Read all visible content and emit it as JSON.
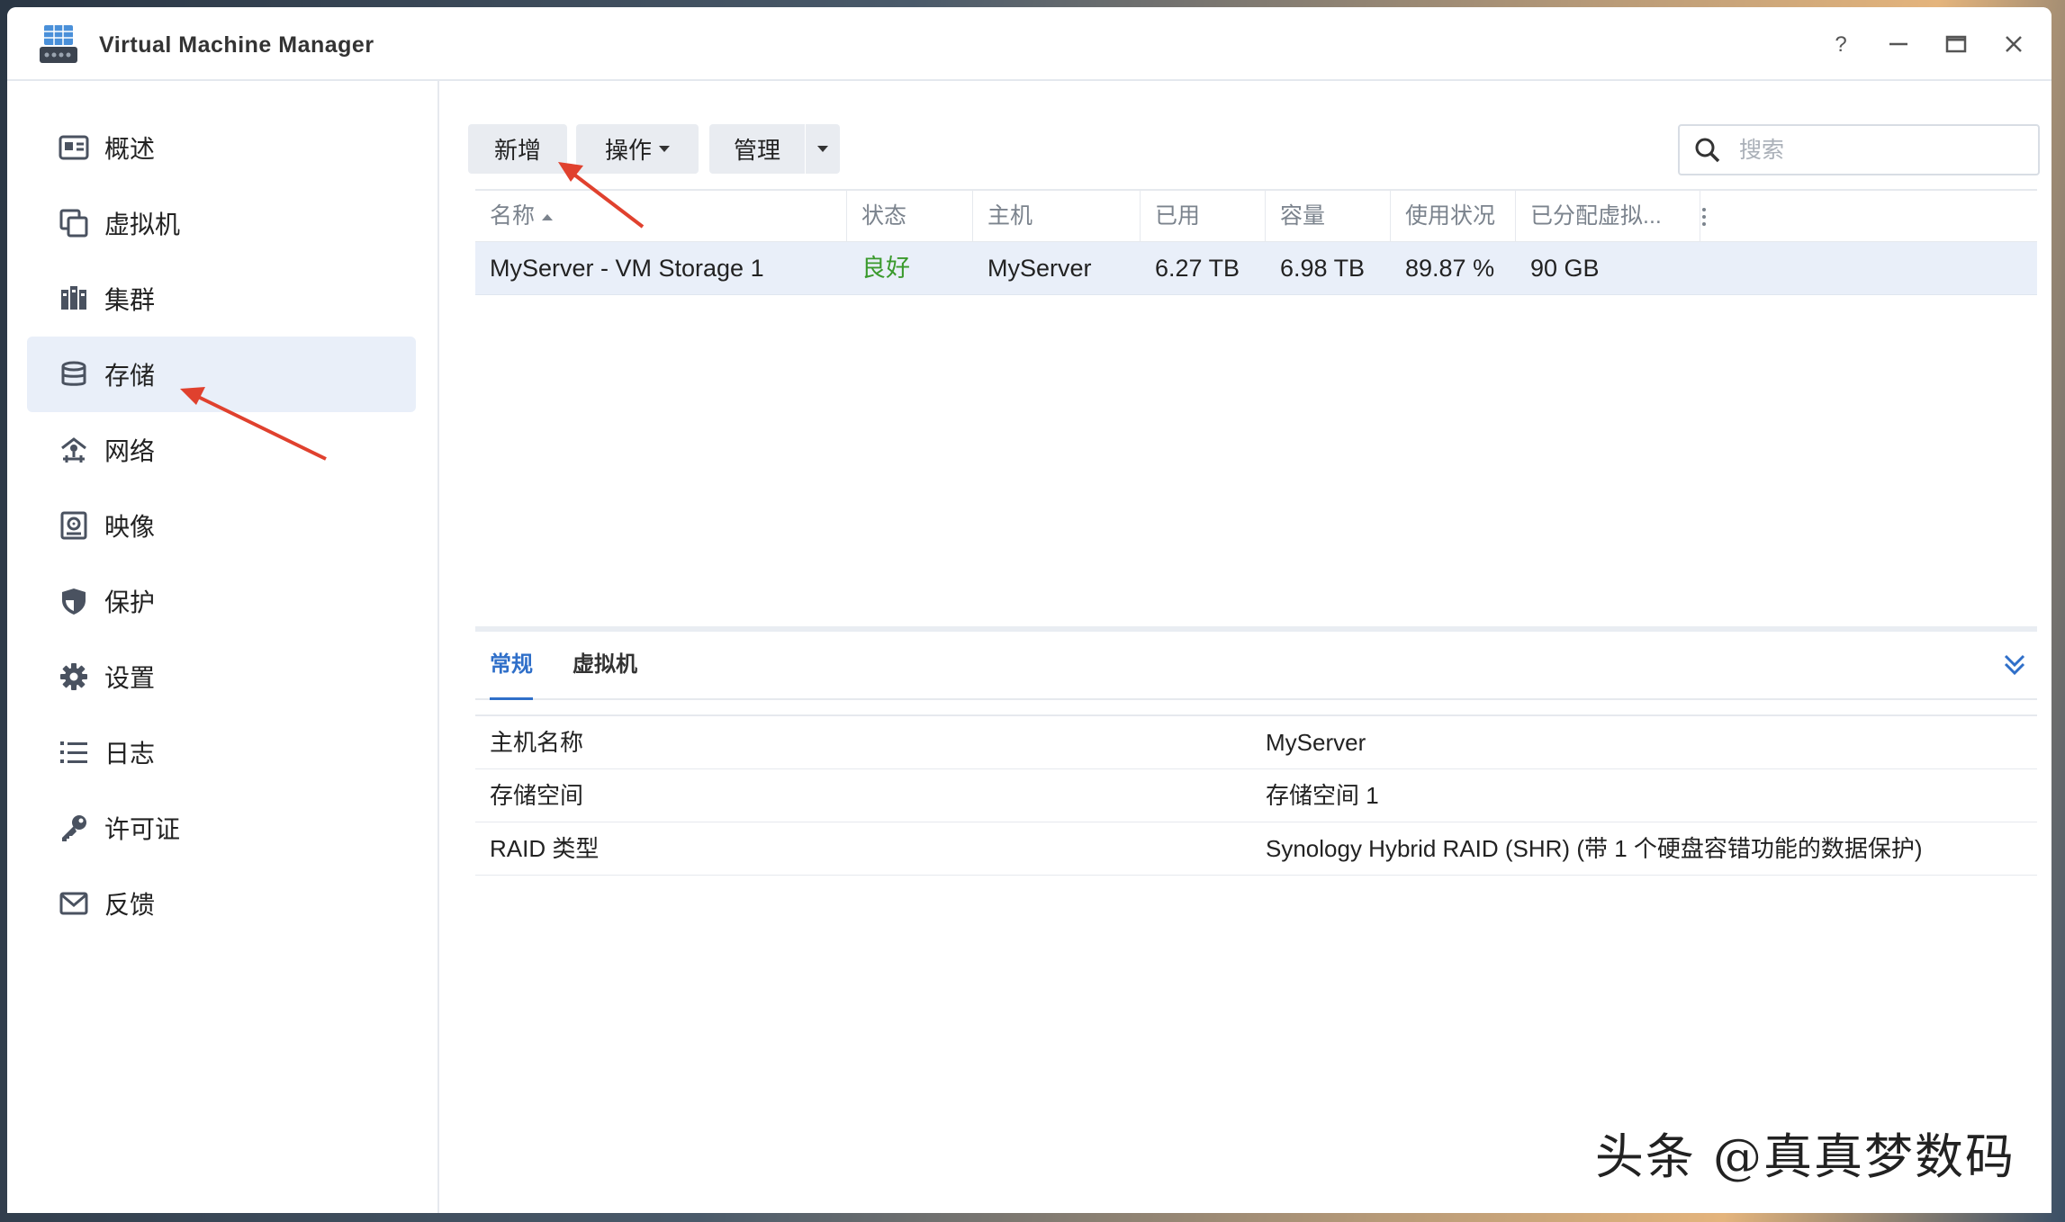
{
  "window": {
    "title": "Virtual Machine Manager"
  },
  "sidebar": {
    "items": [
      {
        "label": "概述",
        "icon": "overview-icon"
      },
      {
        "label": "虚拟机",
        "icon": "virtual-machine-icon"
      },
      {
        "label": "集群",
        "icon": "cluster-icon"
      },
      {
        "label": "存储",
        "icon": "storage-icon",
        "active": true
      },
      {
        "label": "网络",
        "icon": "network-icon"
      },
      {
        "label": "映像",
        "icon": "image-icon"
      },
      {
        "label": "保护",
        "icon": "shield-icon"
      },
      {
        "label": "设置",
        "icon": "gear-icon"
      },
      {
        "label": "日志",
        "icon": "list-icon"
      },
      {
        "label": "许可证",
        "icon": "key-icon"
      },
      {
        "label": "反馈",
        "icon": "mail-icon"
      }
    ]
  },
  "toolbar": {
    "add_label": "新增",
    "action_label": "操作",
    "manage_label": "管理"
  },
  "search": {
    "placeholder": "搜索"
  },
  "table": {
    "columns": [
      "名称",
      "状态",
      "主机",
      "已用",
      "容量",
      "使用状况",
      "已分配虚拟..."
    ],
    "rows": [
      {
        "name": "MyServer - VM Storage 1",
        "status": "良好",
        "host": "MyServer",
        "used": "6.27 TB",
        "capacity": "6.98 TB",
        "usage": "89.87 %",
        "allocated": "90 GB"
      }
    ]
  },
  "tabs": [
    {
      "label": "常规",
      "active": true
    },
    {
      "label": "虚拟机"
    }
  ],
  "details": [
    {
      "key": "主机名称",
      "value": "MyServer"
    },
    {
      "key": "存储空间",
      "value": "存储空间 1"
    },
    {
      "key": "RAID 类型",
      "value": "Synology Hybrid RAID (SHR) (带 1 个硬盘容错功能的数据保护)"
    }
  ],
  "watermark": "头条 @真真梦数码",
  "colors": {
    "accent": "#2f6fc9",
    "status_good": "#3a9a2d",
    "selected_row": "#e9eff9",
    "annotation_arrow": "#e0412e"
  }
}
